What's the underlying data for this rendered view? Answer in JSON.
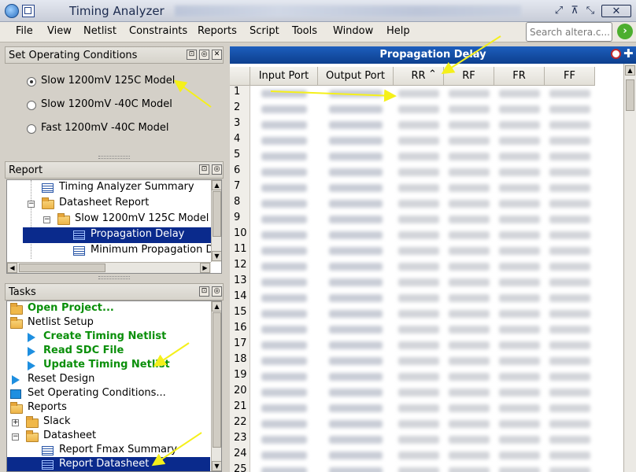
{
  "window": {
    "title": "Timing Analyzer",
    "controls": [
      "⤢",
      "⊼",
      "⤡",
      "✕"
    ]
  },
  "menu": [
    "File",
    "View",
    "Netlist",
    "Constraints",
    "Reports",
    "Script",
    "Tools",
    "Window",
    "Help"
  ],
  "search": {
    "placeholder": "Search altera.c..."
  },
  "operating_conditions": {
    "title": "Set Operating Conditions",
    "options": [
      "Slow 1200mV 125C Model",
      "Slow 1200mV -40C Model",
      "Fast 1200mV -40C Model"
    ],
    "selected": 0
  },
  "report": {
    "title": "Report",
    "items": [
      {
        "label": "Timing Analyzer Summary"
      },
      {
        "label": "Datasheet Report"
      },
      {
        "label": "Slow 1200mV 125C Model"
      },
      {
        "label": "Propagation Delay"
      },
      {
        "label": "Minimum Propagation De"
      }
    ]
  },
  "tasks": {
    "title": "Tasks",
    "items": [
      {
        "label": "Open Project..."
      },
      {
        "label": "Netlist Setup"
      },
      {
        "label": "Create Timing Netlist"
      },
      {
        "label": "Read SDC File"
      },
      {
        "label": "Update Timing Netlist"
      },
      {
        "label": "Reset Design"
      },
      {
        "label": "Set Operating Conditions..."
      },
      {
        "label": "Reports"
      },
      {
        "label": "Slack"
      },
      {
        "label": "Datasheet"
      },
      {
        "label": "Report Fmax Summary"
      },
      {
        "label": "Report Datasheet"
      }
    ]
  },
  "propagation": {
    "title": "Propagation Delay",
    "columns": [
      "Input Port",
      "Output Port",
      "RR",
      "RF",
      "FR",
      "FF"
    ],
    "sort_indicator": "⌃",
    "rows": [
      "1",
      "2",
      "3",
      "4",
      "5",
      "6",
      "7",
      "8",
      "9",
      "10",
      "11",
      "12",
      "13",
      "14",
      "15",
      "16",
      "17",
      "18",
      "19",
      "20",
      "21",
      "22",
      "23",
      "24",
      "25"
    ]
  },
  "colors": {
    "accent": "#0a2a8c",
    "header_blue": "#0d3f8e",
    "task_green": "#0a8f0a",
    "annotation_arrow": "#f5f01a"
  }
}
